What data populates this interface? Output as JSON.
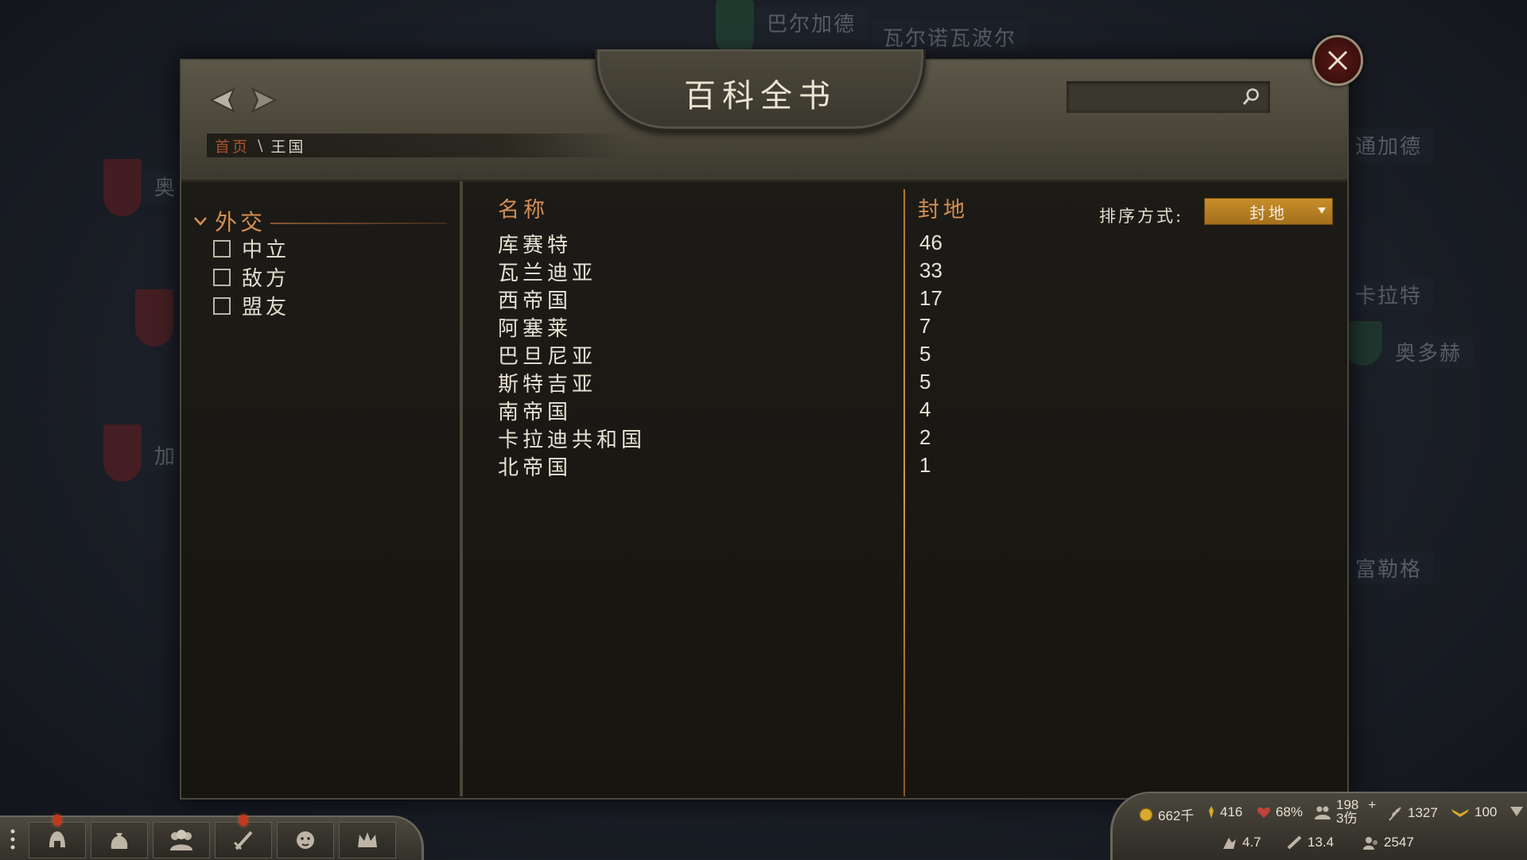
{
  "map": {
    "labels": [
      "巴尔加德",
      "瓦尔诺瓦波尔",
      "通加德",
      "卡拉特",
      "奥多赫",
      "富勒格",
      "奥",
      "加"
    ]
  },
  "encyclopedia": {
    "title": "百科全书",
    "search": {
      "value": "",
      "placeholder": ""
    },
    "breadcrumb": {
      "home": "首页",
      "separator": "\\",
      "current": "王国"
    }
  },
  "sidebar": {
    "section_title": "外交",
    "filters": [
      {
        "label": "中立",
        "checked": false
      },
      {
        "label": "敌方",
        "checked": false
      },
      {
        "label": "盟友",
        "checked": false
      }
    ]
  },
  "list": {
    "col_name": "名称",
    "col_value": "封地",
    "sort_label": "排序方式:",
    "sort_value": "封地",
    "rows": [
      {
        "name": "库赛特",
        "value": "46"
      },
      {
        "name": "瓦兰迪亚",
        "value": "33"
      },
      {
        "name": "西帝国",
        "value": "17"
      },
      {
        "name": "阿塞莱",
        "value": "7"
      },
      {
        "name": "巴旦尼亚",
        "value": "5"
      },
      {
        "name": "斯特吉亚",
        "value": "5"
      },
      {
        "name": "南帝国",
        "value": "4"
      },
      {
        "name": "卡拉迪共和国",
        "value": "2"
      },
      {
        "name": "北帝国",
        "value": "1"
      }
    ]
  },
  "toolbar": {
    "buttons": [
      "menu-icon",
      "helmet-icon",
      "bag-icon",
      "party-icon",
      "sword-icon",
      "lion-icon",
      "crown-icon"
    ]
  },
  "status": {
    "gold": "662千",
    "influence": "416",
    "health": "68%",
    "troops": "198",
    "troops_plus": "+",
    "wounded": "3伤",
    "food": "1327",
    "morale": "100",
    "speed": "4.7",
    "view": "13.4",
    "prisoners": "2547"
  },
  "colors": {
    "accent_orange": "#d28f55",
    "gold_divider": "#d39a3c",
    "sort_bg": "#c88f2a",
    "crumb_link": "#a8532f"
  }
}
